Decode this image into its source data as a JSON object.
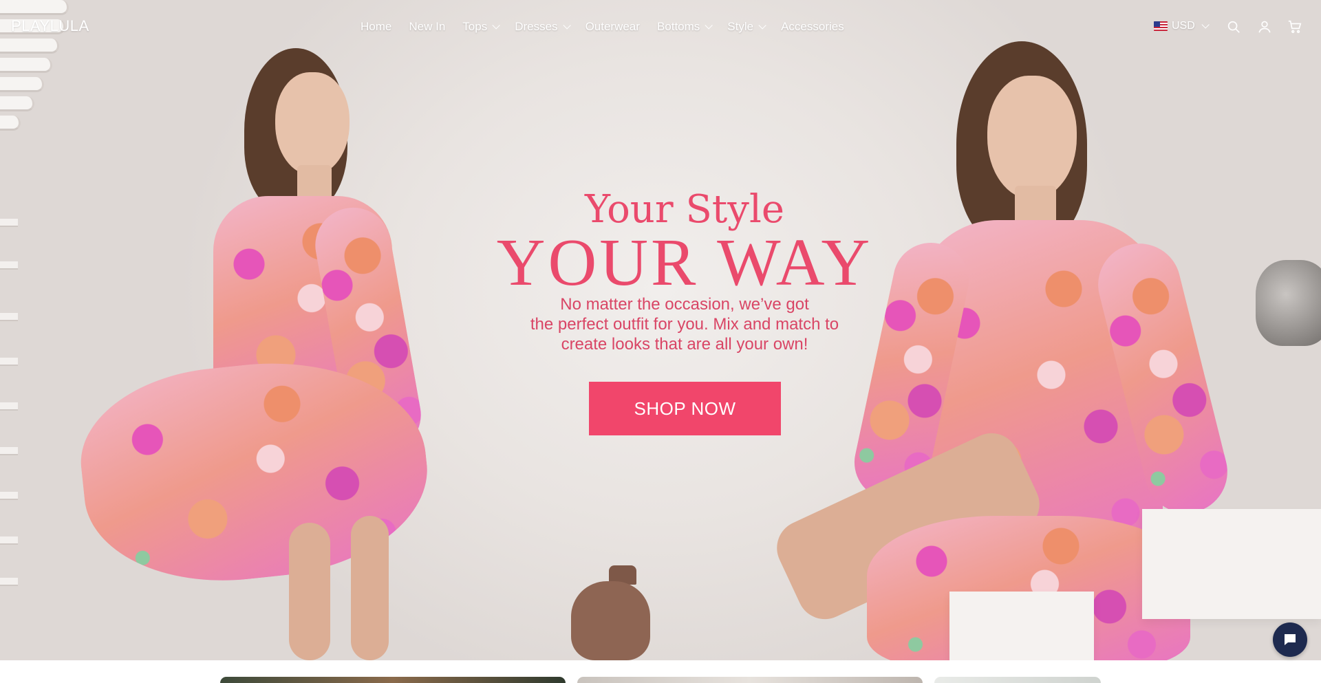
{
  "brand": {
    "logo": "PLAYLULA"
  },
  "nav": {
    "items": [
      {
        "label": "Home",
        "has_dropdown": false
      },
      {
        "label": "New In",
        "has_dropdown": false
      },
      {
        "label": "Tops",
        "has_dropdown": true
      },
      {
        "label": "Dresses",
        "has_dropdown": true
      },
      {
        "label": "Outerwear",
        "has_dropdown": false
      },
      {
        "label": "Bottoms",
        "has_dropdown": true
      },
      {
        "label": "Style",
        "has_dropdown": true
      },
      {
        "label": "Accessories",
        "has_dropdown": false
      }
    ]
  },
  "header": {
    "currency": "USD",
    "icons": [
      "us-flag-icon",
      "search-icon",
      "account-icon",
      "cart-icon"
    ]
  },
  "hero": {
    "kicker": "Your Style",
    "headline": "YOUR WAY",
    "subtext_lines": [
      "No matter the occasion, we’ve got",
      "the perfect outfit for you. Mix and match to",
      "create looks that are all your own!"
    ],
    "cta_label": "SHOP NOW"
  },
  "colors": {
    "accent": "#f1466b",
    "headline": "#ea4a6c",
    "chat_button": "#1e2a4f"
  },
  "chat": {
    "icon": "chat-bubble-icon"
  }
}
